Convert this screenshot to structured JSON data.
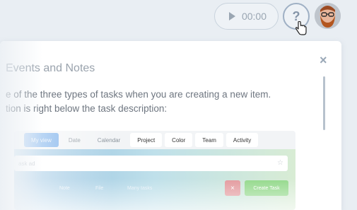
{
  "topbar": {
    "timer": {
      "time": "00:00",
      "icon": "play-icon"
    },
    "help": {
      "label": "?",
      "icon": "help-icon"
    },
    "avatar": {
      "icon": "user-avatar"
    }
  },
  "panel": {
    "close_label": "×",
    "title": "Events and Notes",
    "paragraph_line1": "e of the three types of tasks when you are creating a new item.",
    "paragraph_line2": "tion is right below the task description:"
  },
  "preview": {
    "tabs": [
      {
        "label": "My view",
        "active": true
      },
      {
        "label": "Date"
      },
      {
        "label": "Calendar"
      },
      {
        "label": "Project"
      },
      {
        "label": "Color"
      },
      {
        "label": "Team"
      },
      {
        "label": "Activity"
      }
    ],
    "input_value": "ask ad",
    "actions": {
      "note": "Note",
      "file": "File",
      "many_tasks": "Many tasks",
      "cancel": "×",
      "create": "Create Task"
    }
  },
  "colors": {
    "accent": "#6aa6e8",
    "create": "#94d98c",
    "cancel": "#e39a9e"
  }
}
